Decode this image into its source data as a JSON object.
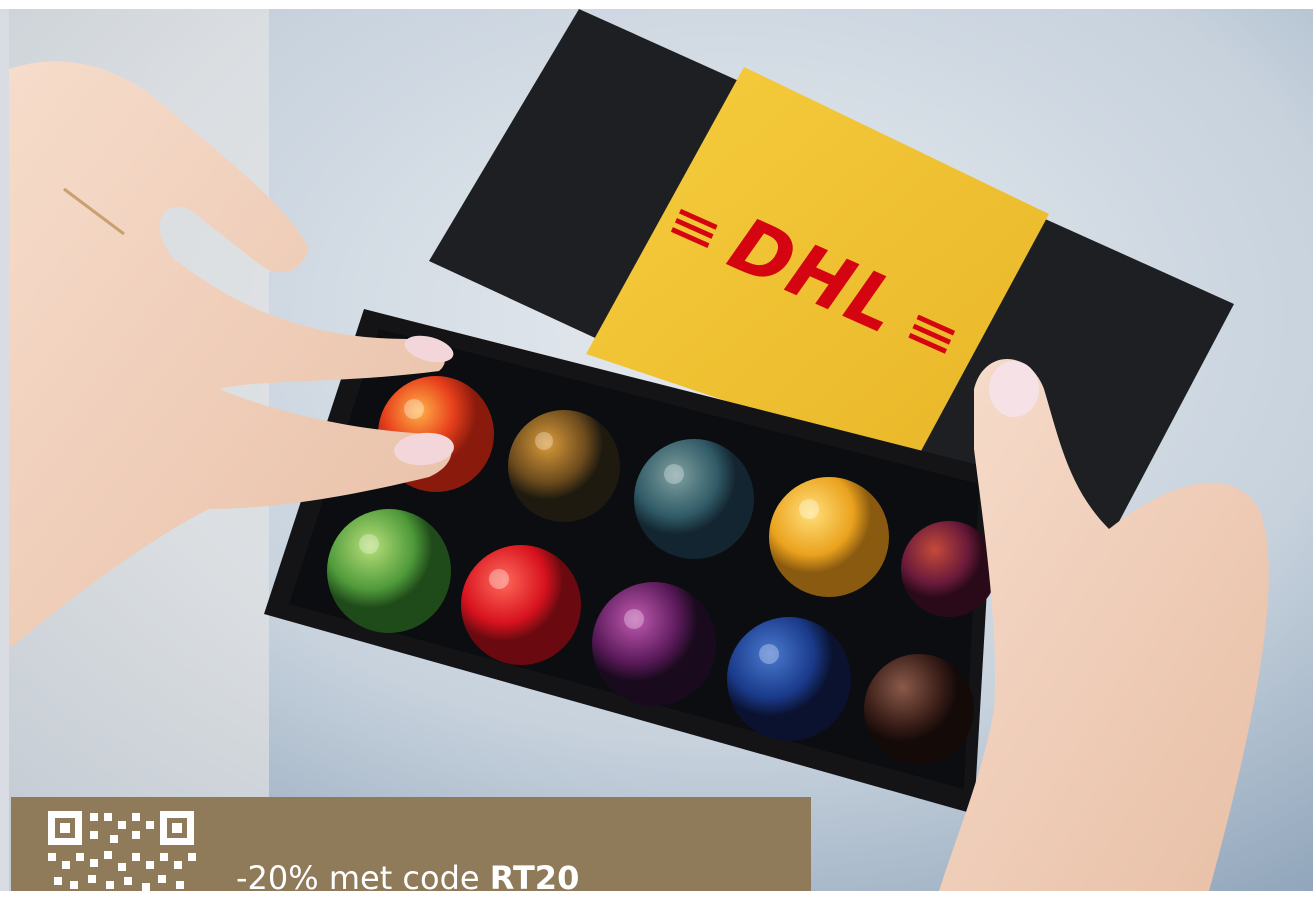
{
  "promo": {
    "text_prefix": "-20% met code ",
    "code": "RT20"
  },
  "colors": {
    "banner": "#8f7a5a",
    "box_sleeve": "#f2c535",
    "logo": "#d40511"
  },
  "icons": [
    "qr-code-icon"
  ]
}
